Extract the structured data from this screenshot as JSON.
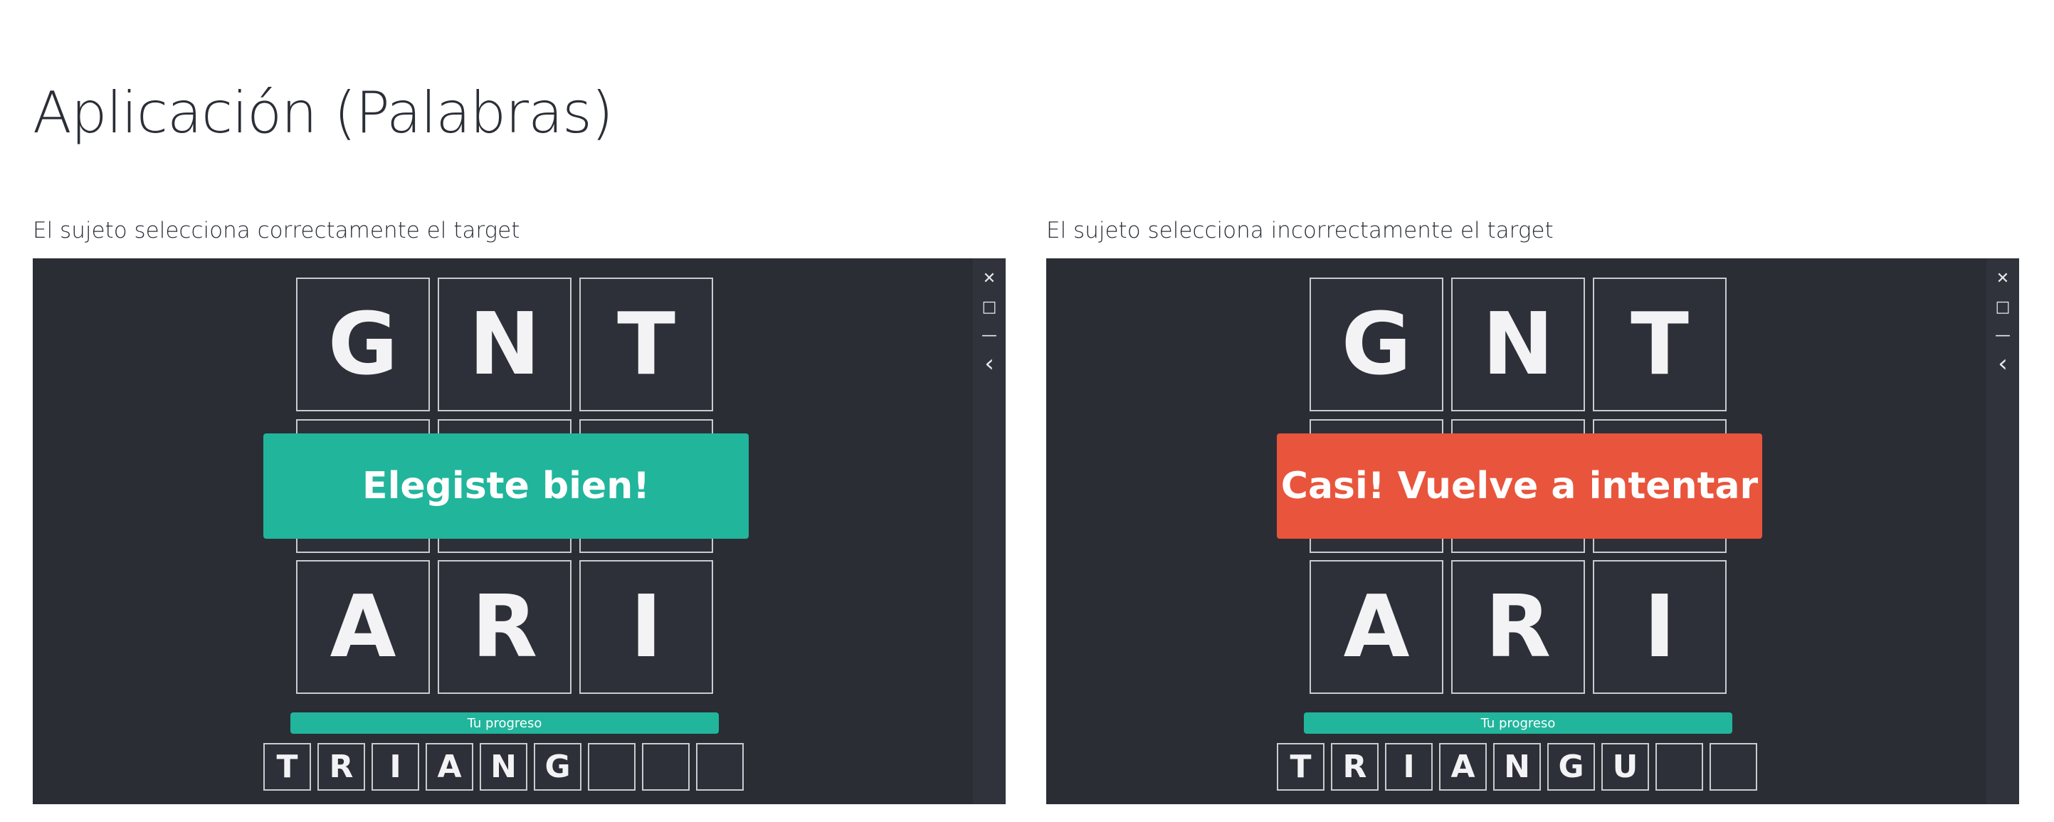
{
  "page": {
    "title": "Aplicación (Palabras)"
  },
  "colors": {
    "background": "#2a2d34",
    "success": "#21b59c",
    "error": "#e8553c",
    "tile_border": "#c9cbd0"
  },
  "window_controls": [
    {
      "icon": "close-icon",
      "glyph": "✕"
    },
    {
      "icon": "maximize-icon",
      "glyph": "□"
    },
    {
      "icon": "minimize-icon",
      "glyph": "—"
    },
    {
      "icon": "back-icon",
      "glyph": "‹"
    }
  ],
  "panels": [
    {
      "caption": "El sujeto selecciona correctamente el target",
      "grid": {
        "top_row": [
          "G",
          "N",
          "T"
        ],
        "bottom_row": [
          "A",
          "R",
          "I"
        ]
      },
      "feedback": {
        "text": "Elegiste bien!",
        "status": "correct",
        "color": "#21b59c"
      },
      "progress_label": "Tu progreso",
      "answer_slots": [
        "T",
        "R",
        "I",
        "A",
        "N",
        "G",
        "",
        "",
        ""
      ]
    },
    {
      "caption": "El sujeto selecciona incorrectamente el target",
      "grid": {
        "top_row": [
          "G",
          "N",
          "T"
        ],
        "bottom_row": [
          "A",
          "R",
          "I"
        ]
      },
      "feedback": {
        "text": "Casi! Vuelve a intentar",
        "status": "incorrect",
        "color": "#e8553c"
      },
      "progress_label": "Tu progreso",
      "answer_slots": [
        "T",
        "R",
        "I",
        "A",
        "N",
        "G",
        "U",
        "",
        ""
      ]
    }
  ]
}
